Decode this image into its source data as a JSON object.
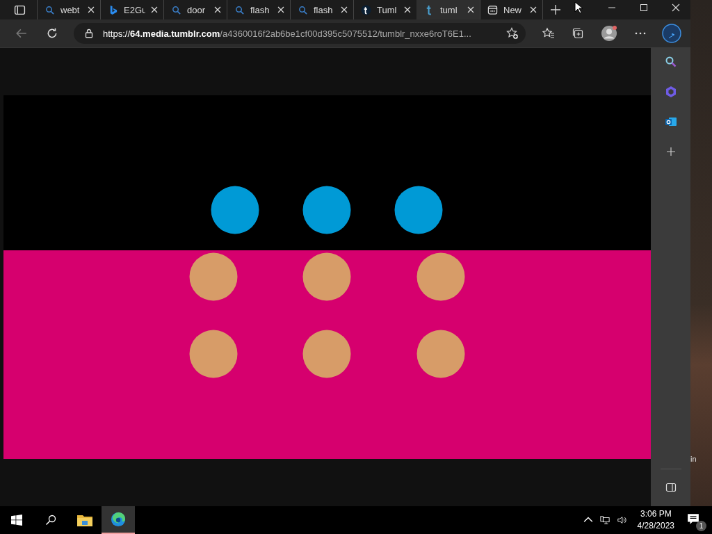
{
  "tabs": [
    {
      "title": "webt",
      "kind": "search",
      "selected": false
    },
    {
      "title": "E2Gu",
      "kind": "bing",
      "selected": false
    },
    {
      "title": "door",
      "kind": "search",
      "selected": false
    },
    {
      "title": "flash",
      "kind": "search",
      "selected": false
    },
    {
      "title": "flash",
      "kind": "search",
      "selected": false
    },
    {
      "title": "Tuml",
      "kind": "tumblr",
      "selected": false
    },
    {
      "title": "tuml",
      "kind": "tumblr-art",
      "selected": true
    },
    {
      "title": "New",
      "kind": "newtab",
      "selected": false
    }
  ],
  "address_bar": {
    "host": "https://**64.media.tumblr.com**",
    "path": "/a4360016f2ab6be1cf00d395c5075512/tumblr_nxxe6roT6E1..."
  },
  "desktop_label": "in",
  "taskbar": {
    "time": "3:06 PM",
    "date": "4/28/2023",
    "notifications": "1"
  }
}
